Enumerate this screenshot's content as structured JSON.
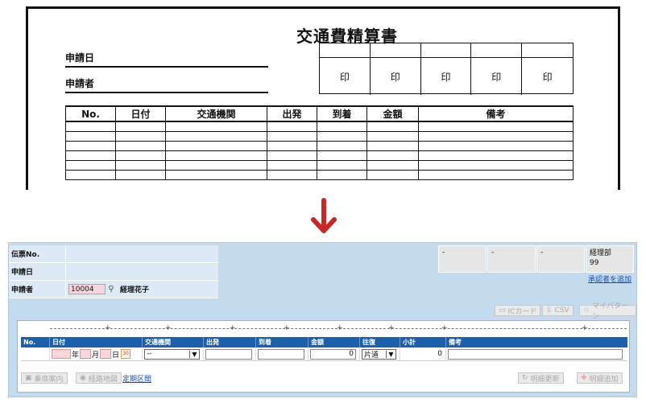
{
  "paper": {
    "title": "交通費精算書",
    "apply_date_label": "申請日",
    "applicant_label": "申請者",
    "stamp": "印",
    "columns": [
      "No.",
      "日付",
      "交通機関",
      "出発",
      "到着",
      "金額",
      "備考"
    ]
  },
  "ui": {
    "slip_no_label": "伝票No.",
    "apply_date_label": "申請日",
    "applicant_label": "申請者",
    "applicant_id": "10004",
    "applicant_name": "経理花子",
    "approvers": [
      "-",
      "-",
      "-"
    ],
    "approver_dept": "経理部",
    "approver_id": "99",
    "add_approver": "承認者を追加",
    "toolbar": {
      "ic_card": "ICカード",
      "csv": "CSV",
      "my_pattern": "マイパターン"
    },
    "columns": [
      "No.",
      "日付",
      "交通機関",
      "出発",
      "到着",
      "金額",
      "往復",
      "小計",
      "備考"
    ],
    "row": {
      "year_label": "年",
      "month_label": "月",
      "day_label": "日",
      "calendar_label": "30",
      "transport_value": "--",
      "amount": "0",
      "trip_value": "片道",
      "subtotal": "0"
    },
    "bottom": {
      "transfer_guide": "乗換案内",
      "route_map": "経路地図",
      "commuter_section": "定期区間",
      "update_detail": "明細更新",
      "add_detail": "明細追加"
    }
  },
  "colors": {
    "header_blue": "#1d5fa8",
    "panel_bg": "#c4dbee",
    "arrow_red": "#c62828",
    "link_blue": "#1b4db0"
  }
}
